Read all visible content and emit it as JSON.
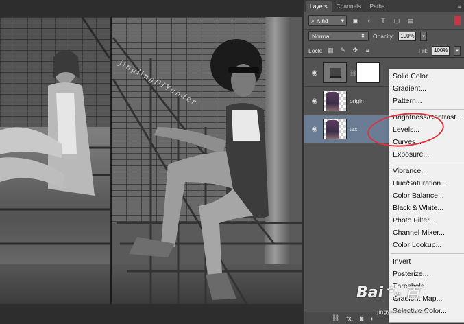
{
  "canvas": {
    "watermark": "jinglingDIYunder"
  },
  "panel": {
    "tabs": [
      {
        "label": "Layers",
        "active": true
      },
      {
        "label": "Channels",
        "active": false
      },
      {
        "label": "Paths",
        "active": false
      }
    ],
    "filter": {
      "kind_label": "Kind"
    },
    "blend_mode": "Normal",
    "opacity_label": "Opacity:",
    "opacity_value": "100%",
    "lock_label": "Lock:",
    "fill_label": "Fill:",
    "fill_value": "100%",
    "layers": [
      {
        "name": "",
        "type": "adjustment",
        "visible": true
      },
      {
        "name": "origin",
        "type": "image",
        "visible": true
      },
      {
        "name": "tex",
        "type": "image",
        "visible": true,
        "selected": true
      }
    ],
    "footer_fx": "fx."
  },
  "adjustment_menu": {
    "items": [
      "Solid Color...",
      "Gradient...",
      "Pattern...",
      "Brightness/Contrast...",
      "Levels...",
      "Curves...",
      "Exposure...",
      "Vibrance...",
      "Hue/Saturation...",
      "Color Balance...",
      "Black & White...",
      "Photo Filter...",
      "Channel Mixer...",
      "Color Lookup...",
      "Invert",
      "Posterize...",
      "Threshold",
      "Gradient Map...",
      "Selective Color..."
    ],
    "highlighted": "Levels...",
    "highlight_color": "#e0323c"
  },
  "watermark_site": {
    "brand": "Bai",
    "brand2": "百",
    "sub": "jingyan.baidu.com"
  }
}
